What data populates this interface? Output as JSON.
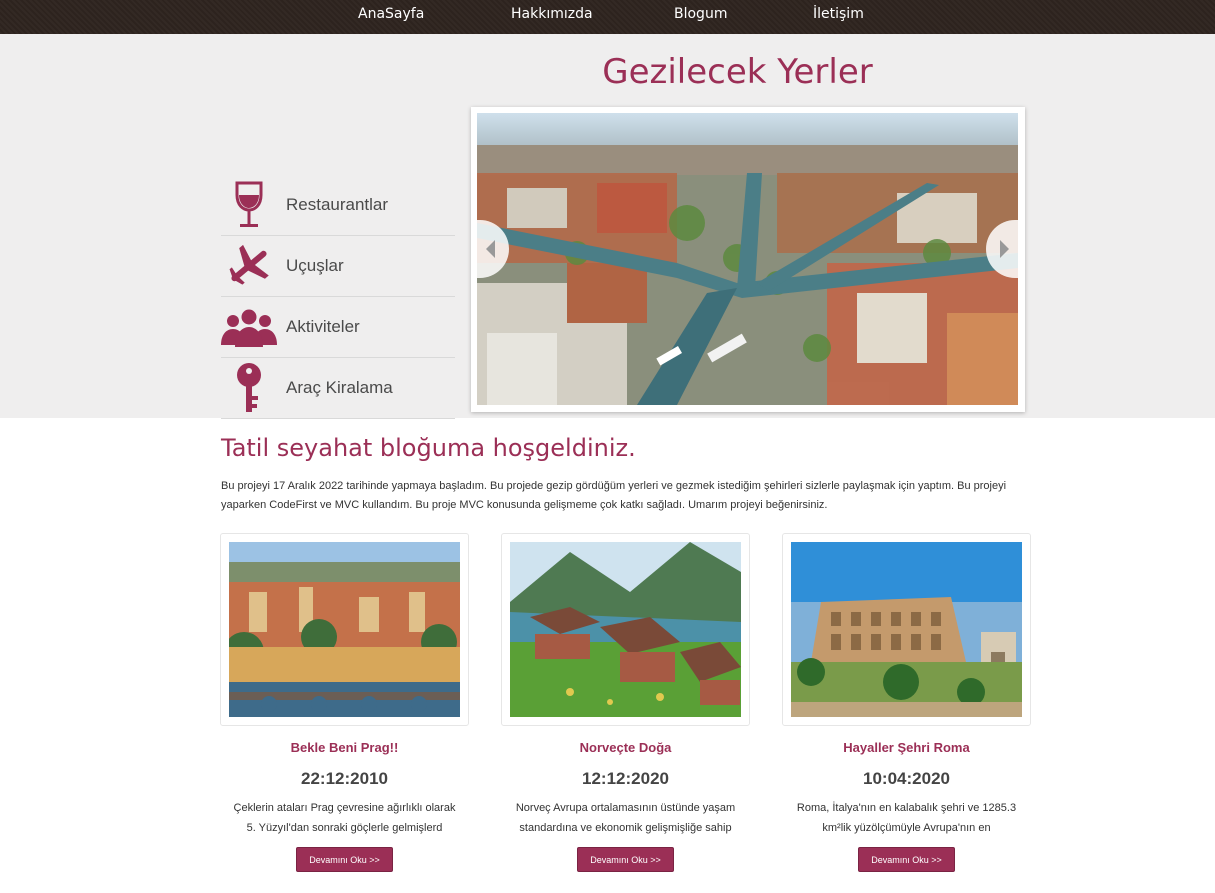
{
  "nav": {
    "items": [
      "AnaSayfa",
      "Hakkımızda",
      "Blogum",
      "İletişim"
    ]
  },
  "hero": {
    "title": "Gezilecek Yerler",
    "side_items": [
      {
        "label": "Restaurantlar",
        "icon": "wine-glass-icon"
      },
      {
        "label": "Uçuşlar",
        "icon": "airplane-icon"
      },
      {
        "label": "Aktiviteler",
        "icon": "people-group-icon"
      },
      {
        "label": "Araç Kiralama",
        "icon": "key-icon"
      }
    ],
    "slider_image": "canal-city-aerial"
  },
  "welcome": {
    "title": "Tatil seyahat bloğuma hoşgeldiniz.",
    "text": "Bu projeyi 17 Aralık 2022 tarihinde yapmaya başladım. Bu projede gezip gördüğüm yerleri ve gezmek istediğim şehirleri sizlerle paylaşmak için yaptım. Bu projeyi yaparken CodeFirst ve MVC kullandım. Bu proje MVC konusunda gelişmeme çok katkı sağladı. Umarım projeyi beğenirsiniz."
  },
  "cards": [
    {
      "title": "Bekle Beni Prag!!",
      "date": "22:12:2010",
      "text": "Çeklerin ataları Prag çevresine ağırlıklı olarak 5. Yüzyıl'dan sonraki göçlerle gelmişlerd",
      "button": "Devamını Oku >>"
    },
    {
      "title": "Norveçte Doğa",
      "date": "12:12:2020",
      "text": "Norveç Avrupa ortalamasının üstünde yaşam standardına ve ekonomik gelişmişliğe sahip olduğ",
      "button": "Devamını Oku >>"
    },
    {
      "title": "Hayaller Şehri Roma",
      "date": "10:04:2020",
      "text": "Roma, İtalya'nın en kalabalık şehri ve 1285.3 km²lik yüzölçümüyle Avrupa'nın en",
      "button": "Devamını Oku >>"
    }
  ],
  "colors": {
    "accent": "#9b2f56",
    "nav_bg": "#2f2520",
    "hero_bg": "#efeeee"
  }
}
